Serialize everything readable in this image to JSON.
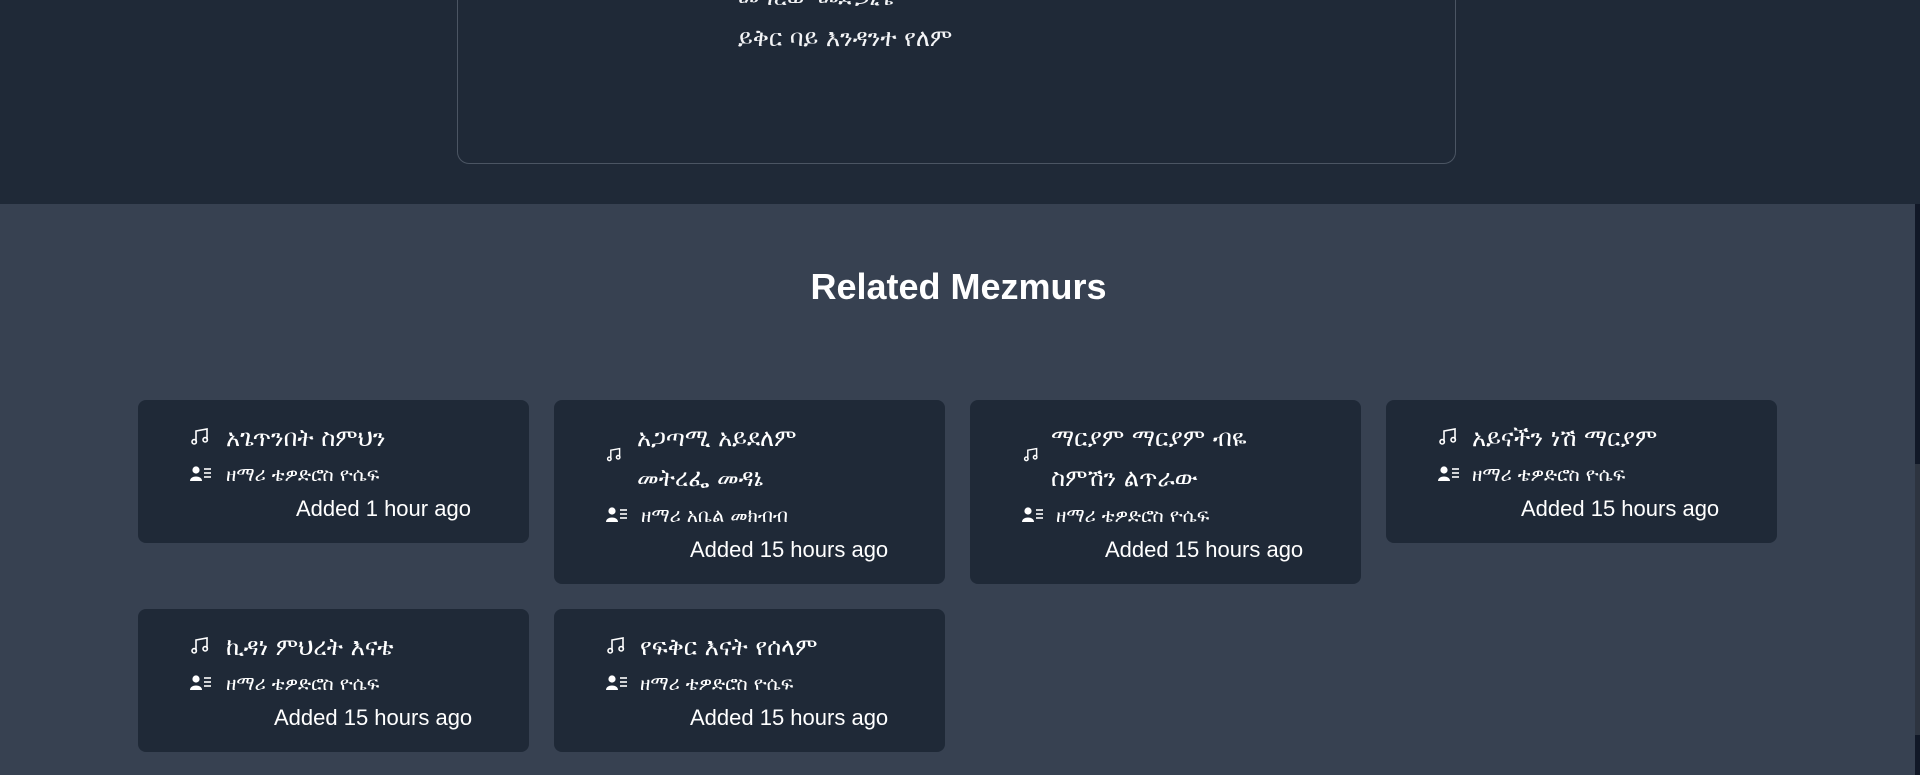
{
  "lyrics": {
    "line1": "መግረው መድኃኒቴ",
    "line2": "ይቅር ባይ እንዳንተ የለም"
  },
  "related": {
    "title": "Related Mezmurs",
    "items": [
      {
        "title": "አጌጥንበት ስምህን",
        "artist": "ዘማሪ ቴዎድሮስ ዮሴፍ",
        "added": "Added 1 hour ago"
      },
      {
        "title": "አጋጣሚ አይደለም መትረፌ መዳኔ",
        "artist": "ዘማሪ አቤል መክብብ",
        "added": "Added 15 hours ago"
      },
      {
        "title": "ማርያም ማርያም ብዬ ስምሽን ልጥራው",
        "artist": "ዘማሪ ቴዎድሮስ ዮሴፍ",
        "added": "Added 15 hours ago"
      },
      {
        "title": "አይናችን ነሽ ማርያም",
        "artist": "ዘማሪ ቴዎድሮስ ዮሴፍ",
        "added": "Added 15 hours ago"
      },
      {
        "title": "ኪዳነ ምህረት እናቴ",
        "artist": "ዘማሪ ቴዎድሮስ ዮሴፍ",
        "added": "Added 15 hours ago"
      },
      {
        "title": "የፍቅር እናት የሰላም",
        "artist": "ዘማሪ ቴዎድሮስ ዮሴፍ",
        "added": "Added 15 hours ago"
      }
    ]
  },
  "icons": {
    "title_icon": "music-note-icon",
    "artist_icon": "user-list-icon"
  },
  "colors": {
    "page_bg": "#374151",
    "header_bg": "#1f2937",
    "card_bg": "#1f2937",
    "text": "#ffffff"
  }
}
